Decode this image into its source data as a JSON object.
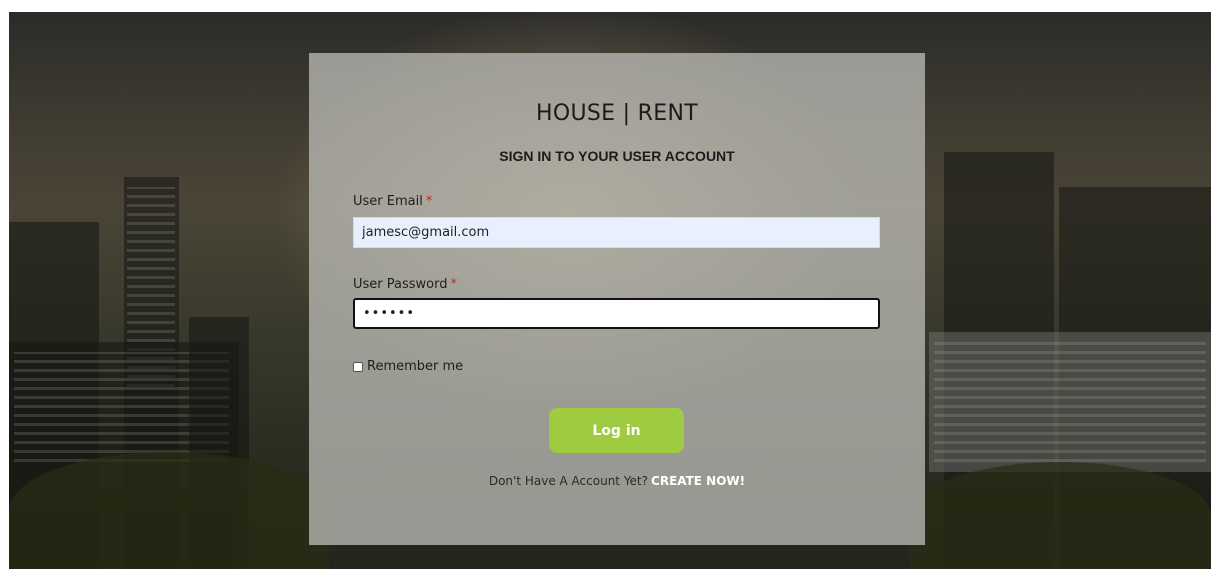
{
  "site": {
    "title": "HOUSE | RENT",
    "subtitle": "SIGN IN TO YOUR USER ACCOUNT"
  },
  "form": {
    "email_label": "User Email",
    "email_value": "jamesc@gmail.com",
    "password_label": "User Password",
    "password_value": "••••••",
    "required_mark": "*",
    "remember_label": "Remember me",
    "remember_checked": false,
    "login_label": "Log in"
  },
  "signup": {
    "prompt": "Don't Have A Account Yet?",
    "link_label": "CREATE NOW!"
  },
  "colors": {
    "accent": "#9ecb3f",
    "required": "#e11d1d",
    "autofill_bg": "#e8f0fe"
  }
}
